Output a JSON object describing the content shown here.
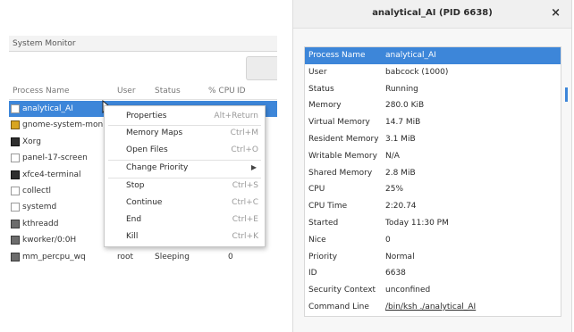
{
  "sysmon": {
    "title": "System Monitor",
    "columns": [
      "Process Name",
      "User",
      "Status",
      "% CPU",
      "ID"
    ],
    "rows": [
      {
        "name": "analytical_AI",
        "icon": "doc",
        "user": "",
        "status": "",
        "cpu": "",
        "selected": true
      },
      {
        "name": "gnome-system-monit",
        "icon": "yel",
        "user": "",
        "status": "",
        "cpu": ""
      },
      {
        "name": "Xorg",
        "icon": "dark",
        "user": "",
        "status": "",
        "cpu": ""
      },
      {
        "name": "panel-17-screen",
        "icon": "doc",
        "user": "",
        "status": "",
        "cpu": ""
      },
      {
        "name": "xfce4-terminal",
        "icon": "dark",
        "user": "",
        "status": "",
        "cpu": ""
      },
      {
        "name": "collectl",
        "icon": "doc",
        "user": "",
        "status": "",
        "cpu": ""
      },
      {
        "name": "systemd",
        "icon": "doc",
        "user": "",
        "status": "",
        "cpu": ""
      },
      {
        "name": "kthreadd",
        "icon": "gear",
        "user": "",
        "status": "",
        "cpu": ""
      },
      {
        "name": "kworker/0:0H",
        "icon": "gear",
        "user": "",
        "status": "",
        "cpu": ""
      },
      {
        "name": "mm_percpu_wq",
        "icon": "gear",
        "user": "root",
        "status": "Sleeping",
        "cpu": "0"
      }
    ]
  },
  "context_menu": {
    "items": [
      {
        "label": "Properties",
        "accel": "Alt+Return"
      },
      {
        "label": "Memory Maps",
        "accel": "Ctrl+M"
      },
      {
        "label": "Open Files",
        "accel": "Ctrl+O"
      },
      {
        "label": "Change Priority",
        "accel": "",
        "submenu": true
      },
      {
        "label": "Stop",
        "accel": "Ctrl+S"
      },
      {
        "label": "Continue",
        "accel": "Ctrl+C"
      },
      {
        "label": "End",
        "accel": "Ctrl+E"
      },
      {
        "label": "Kill",
        "accel": "Ctrl+K"
      }
    ]
  },
  "dialog": {
    "title": "analytical_AI (PID 6638)",
    "close_glyph": "×",
    "properties": [
      {
        "key": "Process Name",
        "value": "analytical_AI"
      },
      {
        "key": "User",
        "value": "babcock (1000)"
      },
      {
        "key": "Status",
        "value": "Running"
      },
      {
        "key": "Memory",
        "value": "280.0 KiB"
      },
      {
        "key": "Virtual Memory",
        "value": "14.7 MiB"
      },
      {
        "key": "Resident Memory",
        "value": "3.1 MiB"
      },
      {
        "key": "Writable Memory",
        "value": "N/A"
      },
      {
        "key": "Shared Memory",
        "value": "2.8 MiB"
      },
      {
        "key": "CPU",
        "value": "25%"
      },
      {
        "key": "CPU Time",
        "value": "2:20.74"
      },
      {
        "key": "Started",
        "value": "Today 11:30 PM"
      },
      {
        "key": "Nice",
        "value": "0"
      },
      {
        "key": "Priority",
        "value": "Normal"
      },
      {
        "key": "ID",
        "value": "6638"
      },
      {
        "key": "Security Context",
        "value": "unconfined"
      },
      {
        "key": "Command Line",
        "value": "/bin/ksh ./analytical_AI"
      }
    ]
  },
  "colors": {
    "selection": "#3d86d9"
  }
}
